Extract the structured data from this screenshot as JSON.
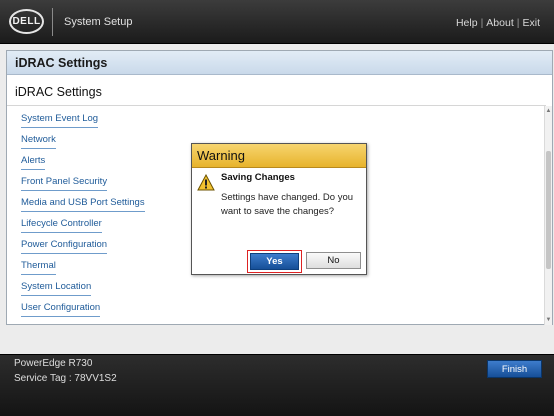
{
  "header": {
    "logo_text": "DELL",
    "app_title": "System Setup",
    "links": {
      "help": "Help",
      "about": "About",
      "exit": "Exit",
      "separator": "|"
    }
  },
  "panel": {
    "header_title": "iDRAC Settings",
    "section_title": "iDRAC Settings",
    "menu_items": [
      "System Event Log",
      "Network",
      "Alerts",
      "Front Panel Security",
      "Media and USB Port Settings",
      "Lifecycle Controller",
      "Power Configuration",
      "Thermal",
      "System Location",
      "User Configuration"
    ]
  },
  "dialog": {
    "title": "Warning",
    "heading": "Saving Changes",
    "message": "Settings have changed. Do you want to save the changes?",
    "yes_label": "Yes",
    "no_label": "No",
    "icon": "warning-icon"
  },
  "footer": {
    "model": "PowerEdge R730",
    "service_tag_label": "Service Tag :",
    "service_tag_value": "78VV1S2",
    "finish_label": "Finish"
  },
  "colors": {
    "link": "#1f5b99",
    "dialog_header": "#e7b32c",
    "primary_button": "#164f98",
    "focus_outline": "#dd2222"
  }
}
